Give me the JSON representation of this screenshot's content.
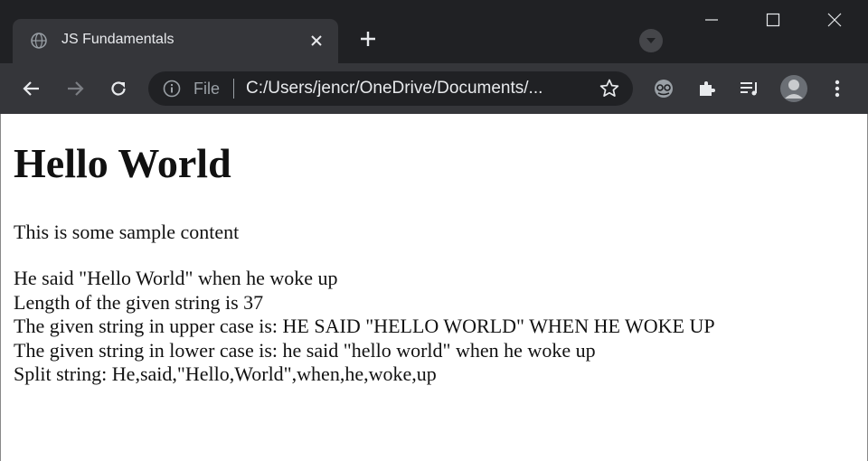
{
  "browser": {
    "tab_title": "JS Fundamentals",
    "omnibox": {
      "scheme_label": "File",
      "url": "C:/Users/jencr/OneDrive/Documents/..."
    }
  },
  "page": {
    "heading": "Hello World",
    "intro": "This is some sample content",
    "output_lines": [
      "He said \"Hello World\" when he woke up",
      "Length of the given string is 37",
      "The given string in upper case is: HE SAID \"HELLO WORLD\" WHEN HE WOKE UP",
      "The given string in lower case is: he said \"hello world\" when he woke up",
      "Split string: He,said,\"Hello,World\",when,he,woke,up"
    ]
  },
  "colors": {
    "titlebar": "#202124",
    "toolbar": "#35363a",
    "icon": "#e8eaed"
  }
}
